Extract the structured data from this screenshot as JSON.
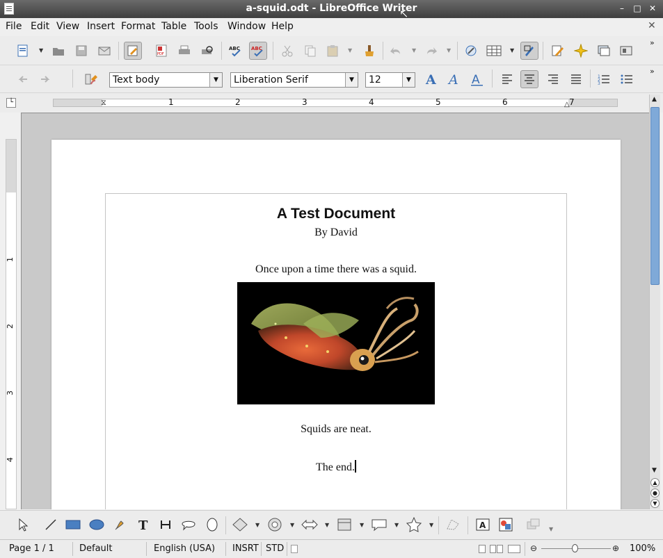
{
  "window": {
    "title": "a-squid.odt - LibreOffice Writer"
  },
  "menubar": {
    "items": [
      "File",
      "Edit",
      "View",
      "Insert",
      "Format",
      "Table",
      "Tools",
      "Window",
      "Help"
    ]
  },
  "formatting": {
    "paragraph_style": "Text body",
    "font_name": "Liberation Serif",
    "font_size": "12"
  },
  "ruler": {
    "numbers": [
      "1",
      "2",
      "3",
      "4",
      "5",
      "6",
      "7"
    ],
    "v_numbers": [
      "1",
      "2",
      "3",
      "4"
    ]
  },
  "document": {
    "title": "A Test Document",
    "byline": "By David",
    "para1": "Once upon a time there was a squid.",
    "para2": "Squids are neat.",
    "para3": "The end."
  },
  "statusbar": {
    "page": "Page 1 / 1",
    "style": "Default",
    "language": "English (USA)",
    "insert_mode": "INSRT",
    "selection_mode": "STD",
    "zoom": "100%"
  },
  "colors": {
    "accent": "#4a7fc1",
    "title_bar": "#4a4a4a"
  },
  "icons": {
    "toolbar1": [
      "new-doc-icon",
      "open-icon",
      "save-icon",
      "email-icon",
      "edit-doc-icon",
      "export-pdf-icon",
      "print-icon",
      "print-preview-icon",
      "spellcheck-icon",
      "autospellcheck-icon",
      "cut-icon",
      "copy-icon",
      "paste-icon",
      "clone-formatting-icon",
      "undo-icon",
      "redo-icon",
      "hyperlink-icon",
      "table-icon",
      "show-draw-functions-icon",
      "find-replace-icon",
      "navigator-icon",
      "gallery-icon",
      "data-sources-icon"
    ]
  }
}
